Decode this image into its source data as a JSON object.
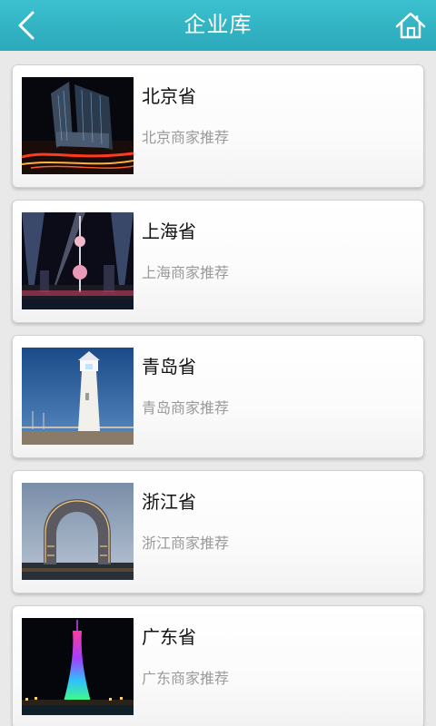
{
  "header": {
    "title": "企业库",
    "back_icon": "chevron-left-icon",
    "home_icon": "home-icon",
    "background": "#2fb3c3"
  },
  "list": {
    "items": [
      {
        "title": "北京省",
        "subtitle": "北京商家推荐",
        "image": "beijing-cctv-tower-night-photo"
      },
      {
        "title": "上海省",
        "subtitle": "上海商家推荐",
        "image": "shanghai-oriental-pearl-night-photo"
      },
      {
        "title": "青岛省",
        "subtitle": "青岛商家推荐",
        "image": "qingdao-lighthouse-photo"
      },
      {
        "title": "浙江省",
        "subtitle": "浙江商家推荐",
        "image": "zhejiang-horseshoe-hotel-photo"
      },
      {
        "title": "广东省",
        "subtitle": "广东商家推荐",
        "image": "guangzhou-canton-tower-night-photo"
      }
    ]
  }
}
